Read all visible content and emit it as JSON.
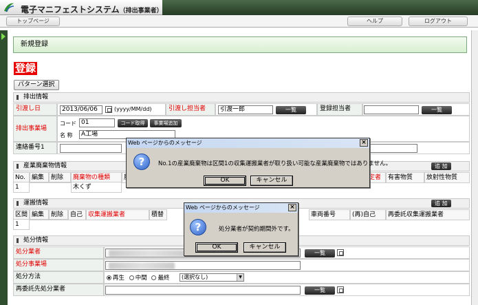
{
  "app": {
    "title": "電子マニフェストシステム",
    "subtitle": "（排出事業者）"
  },
  "nav": {
    "top": "トップページ",
    "help": "ヘルプ",
    "logout": "ログアウト"
  },
  "page": {
    "header": "新規登録",
    "register_label": "登録",
    "pattern_button": "パターン選択"
  },
  "haishutsu": {
    "section": "排出情報",
    "hikiwatashi_bi_label": "引渡し日",
    "hikiwatashi_bi_value": "2013/06/06",
    "date_format": "(yyyy/MM/dd)",
    "tantousha_label": "引渡し担当者",
    "tantousha_value": "引渡一郎",
    "ichiran": "一覧",
    "touroku_label": "登録担当者",
    "jigyoujou_label": "排出事業場",
    "code_label": "コード",
    "code_value": "01",
    "code_btn": "コード取得",
    "jigyoujou_add_btn": "事業場追加",
    "name_label": "名 称",
    "name_value": "A工場",
    "renraku_label": "連絡番号1"
  },
  "sanpai": {
    "section": "産業廃棄物情報",
    "add_btn": "追 加",
    "headers": [
      "No.",
      "編集",
      "削除",
      "廃棄物の種類",
      "廃",
      "定者",
      "有害物質",
      "放射性物質"
    ],
    "row": {
      "no": "1",
      "kind": "木くず"
    }
  },
  "unpan": {
    "section": "運搬情報",
    "add_btn": "追 加",
    "headers": [
      "区間",
      "編集",
      "削除",
      "自己",
      "収集運搬業者",
      "積替",
      "車両番号",
      "(再)自己",
      "再委託収集運搬業者"
    ],
    "row": {
      "no": "1"
    }
  },
  "shobun": {
    "section": "処分情報",
    "gyousha_label": "処分業者",
    "jigyoujou_label": "処分事業場",
    "houhou_label": "処分方法",
    "options": [
      "再生",
      "中間",
      "最終"
    ],
    "select_value": "(選択なし)",
    "saiitaku_label": "再委託先処分業者",
    "ichiran": "一覧"
  },
  "dialog1": {
    "title": "Web ページからのメッセージ",
    "message": "No.1の産業廃棄物は区間1の収集運搬業者が取り扱い可能な産業廃棄物ではありません。",
    "ok": "OK",
    "cancel": "キャンセル"
  },
  "dialog2": {
    "title": "Web ページからのメッセージ",
    "message": "処分業者が契約期間外です。",
    "ok": "OK",
    "cancel": "キャンセル"
  }
}
